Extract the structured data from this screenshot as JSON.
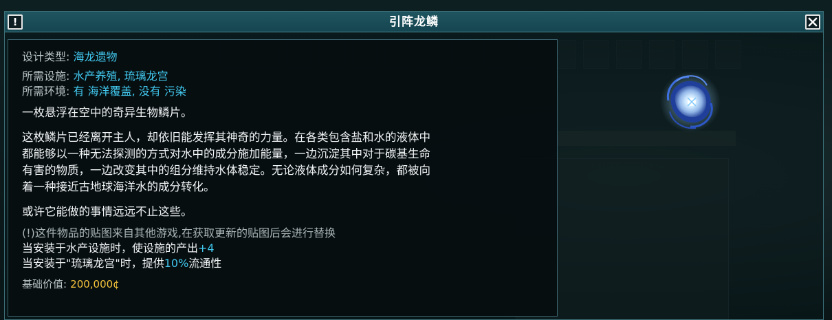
{
  "window": {
    "title": "引阵龙鳞"
  },
  "item": {
    "design_type_label": "设计类型:",
    "design_type_value": "海龙遗物",
    "facility_label": "所需设施:",
    "facility_value": "水产养殖, 琉璃龙宫",
    "environment_label": "所需环境:",
    "environment_value": "有 海洋覆盖, 没有 污染",
    "summary": "一枚悬浮在空中的奇异生物鳞片。",
    "description": [
      "这枚鳞片已经离开主人，却依旧能发挥其神奇的力量。在各类包含盐和水的液体中",
      "都能够以一种无法探测的方式对水中的成分施加能量，一边沉淀其中对于碳基生命",
      "有害的物质，一边改变其中的组分维持水体稳定。无论液体成分如何复杂，都被向",
      "着一种接近古地球海洋水的成分转化。"
    ],
    "flavor": "或许它能做的事情远远不止这些。",
    "notice": "(!)这件物品的贴图来自其他游戏,在获取更新的贴图后会进行替换",
    "effect1_text": "当安装于水产设施时，使设施的产出",
    "effect1_value": "+4",
    "effect2_text": "当安装于\"琉璃龙宫\"时，提供",
    "effect2_value": "10%",
    "effect2_suffix": "流通性",
    "price_label": "基础价值:",
    "price_value": "200,000¢"
  },
  "colors": {
    "accent": "#42c9f0",
    "price": "#f5c33b",
    "titlebar": "#1f5560"
  },
  "icons": {
    "info": "info-icon",
    "close": "close-icon",
    "item": "dragon-scale-icon"
  }
}
